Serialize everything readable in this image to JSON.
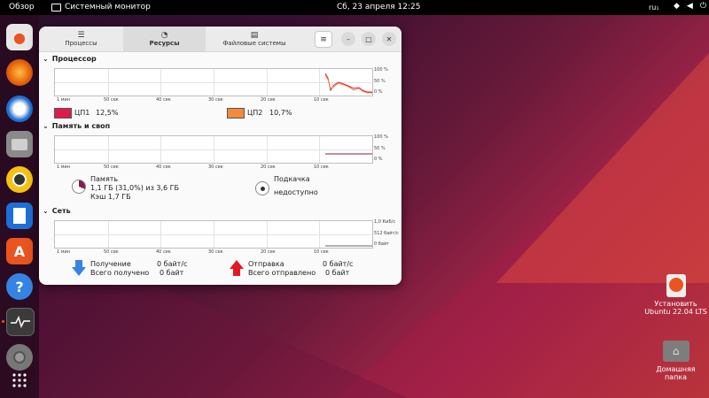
{
  "topbar": {
    "overview": "Обзор",
    "app_title": "Системный монитор",
    "clock": "Сб, 23 апреля  12:25",
    "lang": "ru₁"
  },
  "desktop": {
    "install_line1": "Установить",
    "install_line2": "Ubuntu 22.04 LTS",
    "home_line1": "Домашняя",
    "home_line2": "папка"
  },
  "tabs": {
    "processes": "Процессы",
    "resources": "Ресурсы",
    "filesystems": "Файловые системы"
  },
  "cpu": {
    "title": "Процессор",
    "ticks": [
      "1 мин",
      "50 сек",
      "40 сек",
      "30 сек",
      "20 сек",
      "10 сек"
    ],
    "ylabels": [
      "100 %",
      "50 %",
      "0 %"
    ],
    "cpu1_label": "ЦП1",
    "cpu1_value": "12,5%",
    "cpu1_color": "#e01b4c",
    "cpu2_label": "ЦП2",
    "cpu2_value": "10,7%",
    "cpu2_color": "#f08a3c"
  },
  "memory": {
    "title": "Память и своп",
    "ticks": [
      "1 мин",
      "50 сек",
      "40 сек",
      "30 сек",
      "20 сек",
      "10 сек"
    ],
    "ylabels": [
      "100 %",
      "50 %",
      "0 %"
    ],
    "mem_label": "Память",
    "mem_value": "1,1 ГБ (31,0%) из 3,6 ГБ",
    "cache": "Кэш 1,7 ГБ",
    "swap_label": "Подкачка",
    "swap_value": "недоступно",
    "mem_fraction": 0.31,
    "mem_color": "#8b1a52"
  },
  "network": {
    "title": "Сеть",
    "ticks": [
      "1 мин",
      "50 сек",
      "40 сек",
      "30 сек",
      "20 сек",
      "10 сек"
    ],
    "ylabels": [
      "1,0 КиБ/с",
      "512 байт/с",
      "0 байт"
    ],
    "recv_label": "Получение",
    "recv_rate": "0 байт/с",
    "recv_total_label": "Всего получено",
    "recv_total": "0 байт",
    "send_label": "Отправка",
    "send_rate": "0 байт/с",
    "send_total_label": "Всего отправлено",
    "send_total": "0 байт"
  },
  "colors": {
    "accent": "#e95420",
    "recv_arrow": "#3584e4",
    "send_arrow": "#e01b24"
  }
}
